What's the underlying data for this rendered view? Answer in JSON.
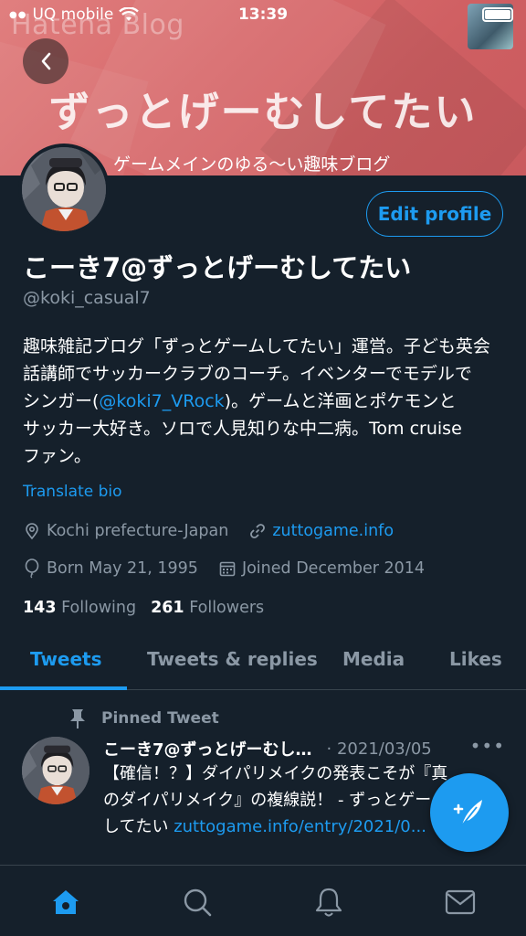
{
  "status_bar": {
    "carrier": "UQ mobile",
    "time": "13:39"
  },
  "banner": {
    "blog_brand": "Hatena Blog",
    "title": "ずっとげーむしてたい",
    "subtitle": "ゲームメインのゆる〜い趣味ブログ"
  },
  "profile": {
    "edit_button": "Edit profile",
    "name": "こーき7@ずっとげーむしてたい",
    "handle": "@koki_casual7",
    "bio_lines": [
      "趣味雑記ブログ「ずっとゲームしてたい」運営。子ども英会",
      "話講師でサッカークラブのコーチ。イベンターでモデルで",
      "シンガー(",
      "@koki7_VRock",
      ")。ゲームと洋画とポケモンと",
      "サッカー大好き。ソロで人見知りな中二病。Tom cruise",
      "ファン。"
    ],
    "translate": "Translate bio",
    "location": "Kochi prefecture-Japan",
    "website": "zuttogame.info",
    "born": "Born May 21, 1995",
    "joined": "Joined December 2014",
    "following_count": "143",
    "following_label": "Following",
    "followers_count": "261",
    "followers_label": "Followers"
  },
  "tabs": [
    {
      "label": "Tweets",
      "active": true
    },
    {
      "label": "Tweets & replies",
      "active": false
    },
    {
      "label": "Media",
      "active": false
    },
    {
      "label": "Likes",
      "active": false
    }
  ],
  "pinned_tweet": {
    "pinned_label": "Pinned Tweet",
    "author": "こーき7@ずっとげーむし…",
    "date": "· 2021/03/05",
    "more": "•••",
    "text_line1": "【確信！？】ダイパリメイクの発表こそが『真",
    "text_line2": "のダイパリメイク』の複線説！ - ずっとゲーム",
    "text_line3_prefix": "してたい ",
    "text_line3_link": "zuttogame.info/entry/2021/0..."
  },
  "colors": {
    "accent": "#1d9bf0",
    "background": "#15202b",
    "secondary_text": "#8b98a5",
    "banner": "#d86a6c"
  },
  "icons": [
    "back-icon",
    "wifi-icon",
    "battery-icon",
    "location-icon",
    "link-icon",
    "balloon-icon",
    "calendar-icon",
    "pin-icon",
    "compose-icon",
    "home-icon",
    "search-icon",
    "bell-icon",
    "mail-icon"
  ]
}
